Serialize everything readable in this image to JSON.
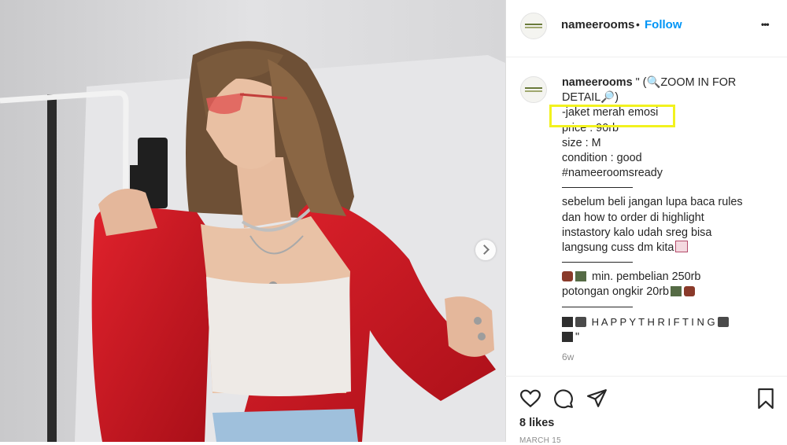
{
  "post": {
    "username": "nameerooms",
    "follow_label": "Follow",
    "dot": "•",
    "more_label": "•••"
  },
  "caption": {
    "username": "nameerooms",
    "line1": " \" (🔍ZOOM IN FOR",
    "line2": "DETAIL🔎)",
    "line3": "-jaket merah emosi",
    "line4": "price : 90rb",
    "line5": "size : M",
    "line6": "condition : good",
    "line7": "#nameeroomsready",
    "rules1": "sebelum beli jangan lupa baca rules",
    "rules2": "dan how to order di highlight",
    "rules3": "instastory kalo udah sreg bisa",
    "rules4": "langsung cuss dm kita",
    "min1": " min. pembelian 250rb",
    "min2": "potongan ongkir 20rb",
    "happy": " H A P P Y T H R I F T I N G ",
    "quote": "\"",
    "time": "6w"
  },
  "footer": {
    "likes": "8 likes",
    "date": "MARCH 15"
  },
  "colors": {
    "accent": "#0095f6",
    "highlight": "#f2f21e",
    "jacket": "#c8151f"
  }
}
